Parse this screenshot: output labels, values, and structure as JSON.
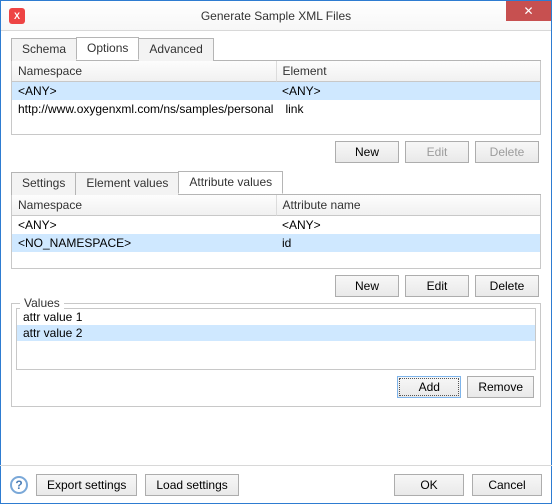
{
  "window": {
    "title": "Generate Sample XML Files"
  },
  "mainTabs": {
    "items": [
      "Schema",
      "Options",
      "Advanced"
    ],
    "active": 1
  },
  "nsTable": {
    "headers": [
      "Namespace",
      "Element"
    ],
    "rows": [
      {
        "ns": "<ANY>",
        "el": "<ANY>",
        "selected": true
      },
      {
        "ns": "http://www.oxygenxml.com/ns/samples/personal",
        "el": "link",
        "selected": false
      }
    ],
    "buttons": {
      "new": "New",
      "edit": "Edit",
      "del": "Delete"
    }
  },
  "subTabs": {
    "items": [
      "Settings",
      "Element values",
      "Attribute values"
    ],
    "active": 2
  },
  "attrTable": {
    "headers": [
      "Namespace",
      "Attribute name"
    ],
    "rows": [
      {
        "ns": "<ANY>",
        "attr": "<ANY>",
        "selected": false
      },
      {
        "ns": "<NO_NAMESPACE>",
        "attr": "id",
        "selected": true
      }
    ],
    "buttons": {
      "new": "New",
      "edit": "Edit",
      "del": "Delete"
    }
  },
  "values": {
    "legend": "Values",
    "items": [
      {
        "text": "attr value 1",
        "selected": false
      },
      {
        "text": "attr value 2",
        "selected": true
      }
    ],
    "buttons": {
      "add": "Add",
      "remove": "Remove"
    }
  },
  "bottom": {
    "export": "Export settings",
    "load": "Load settings",
    "ok": "OK",
    "cancel": "Cancel"
  }
}
